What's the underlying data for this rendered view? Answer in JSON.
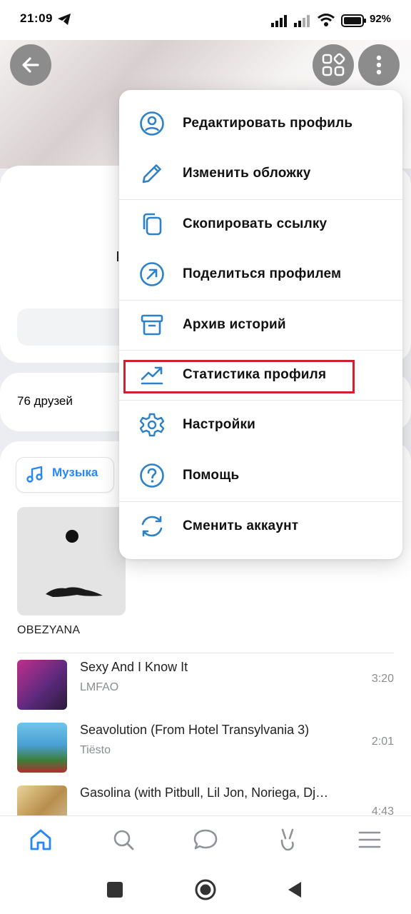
{
  "status_bar": {
    "time": "21:09",
    "battery": "92%"
  },
  "profile": {
    "friends_count": "76 друзей"
  },
  "menu": {
    "items": [
      {
        "label": "Редактировать профиль",
        "icon": "user-circle-icon"
      },
      {
        "label": "Изменить обложку",
        "icon": "pencil-icon"
      },
      {
        "label": "Скопировать ссылку",
        "icon": "copy-icon"
      },
      {
        "label": "Поделиться профилем",
        "icon": "share-arrow-icon"
      },
      {
        "label": "Архив историй",
        "icon": "archive-icon"
      },
      {
        "label": "Статистика профиля",
        "icon": "chart-trend-icon"
      },
      {
        "label": "Настройки",
        "icon": "gear-icon"
      },
      {
        "label": "Помощь",
        "icon": "help-icon"
      },
      {
        "label": "Сменить аккаунт",
        "icon": "switch-account-icon"
      }
    ],
    "highlighted": "Статистика профиля"
  },
  "music": {
    "chip_label": "Музыка",
    "album_title": "OBEZYANA",
    "tracks": [
      {
        "title": "Sexy And I Know It",
        "artist": "LMFAO",
        "duration": "3:20"
      },
      {
        "title": "Seavolution (From Hotel Transylvania 3)",
        "artist": "Tiësto",
        "duration": "2:01"
      },
      {
        "title": "Gasolina (with Pitbull, Lil Jon, Noriega, Dj…",
        "artist": "",
        "duration": "4:43"
      }
    ]
  },
  "colors": {
    "accent": "#2787f5",
    "menu_icon": "#2d81c8",
    "highlight_border": "#d0202e"
  }
}
